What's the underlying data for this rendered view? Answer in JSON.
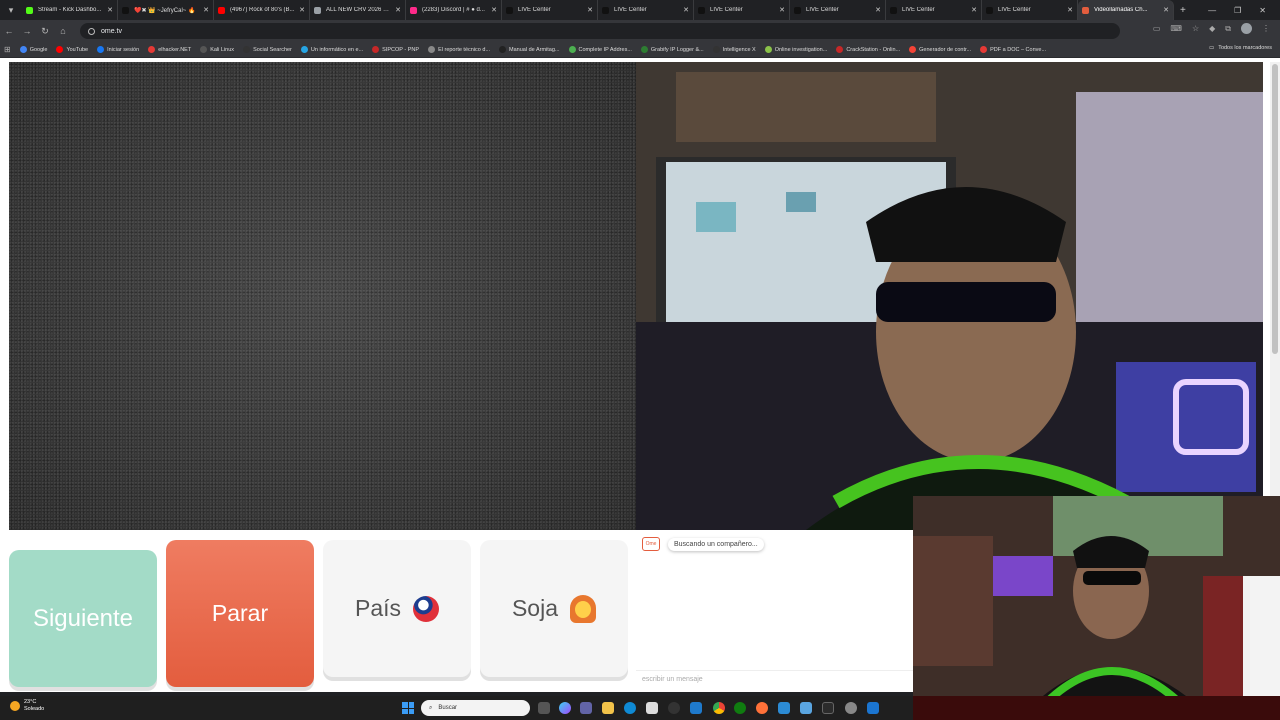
{
  "tabs": [
    {
      "label": "Stream - Kick Dashbo...",
      "color": "#53fc18"
    },
    {
      "label": "❤️✖ 👑 ~JefryCal~ 🔥",
      "color": "#111111"
    },
    {
      "label": "(4967) Rock of 80's (B...",
      "color": "#ff0000"
    },
    {
      "label": "ALL NEW CRV 2026 Ch...",
      "color": "#9aa0a6"
    },
    {
      "label": "(2283) Discord | # ● d...",
      "color": "#ff2a8a"
    },
    {
      "label": "LIVE Center",
      "color": "#111111"
    },
    {
      "label": "LIVE Center",
      "color": "#111111"
    },
    {
      "label": "LIVE Center",
      "color": "#111111"
    },
    {
      "label": "LIVE Center",
      "color": "#111111"
    },
    {
      "label": "LIVE Center",
      "color": "#111111"
    },
    {
      "label": "LIVE Center",
      "color": "#111111"
    },
    {
      "label": "Videollamadas Ch...",
      "color": "#e35d3e",
      "active": true
    }
  ],
  "address": {
    "url": "ome.tv"
  },
  "bookmarks": [
    {
      "label": "Google",
      "color": "#4285f4"
    },
    {
      "label": "YouTube",
      "color": "#ff0000"
    },
    {
      "label": "Iniciar sesión",
      "color": "#1877f2"
    },
    {
      "label": "elhacker.NET",
      "color": "#e53935"
    },
    {
      "label": "Kali Linux",
      "color": "#555555"
    },
    {
      "label": "Social Searcher",
      "color": "#333333"
    },
    {
      "label": "Un informático en e...",
      "color": "#26a5e4"
    },
    {
      "label": "SIPCOP - PNP",
      "color": "#c62828"
    },
    {
      "label": "El reporte técnico d...",
      "color": "#888888"
    },
    {
      "label": "Manual de Armitag...",
      "color": "#222222"
    },
    {
      "label": "Complete IP Addres...",
      "color": "#4caf50"
    },
    {
      "label": "Grabify IP Logger &...",
      "color": "#2e7d32"
    },
    {
      "label": "Intelligence X",
      "color": "#333333"
    },
    {
      "label": "Online investigation...",
      "color": "#8bc34a"
    },
    {
      "label": "CrackStation - Onlin...",
      "color": "#c62828"
    },
    {
      "label": "Generador de contr...",
      "color": "#f44336"
    },
    {
      "label": "PDF a DOC – Conve...",
      "color": "#e53935"
    }
  ],
  "bookmarks_all": "Todos los marcadores",
  "buttons": {
    "next": "Siguiente",
    "stop": "Parar",
    "country": "País",
    "soja": "Soja"
  },
  "chat": {
    "status": "Buscando un compañero...",
    "placeholder": "escribir un mensaje",
    "logo": "Ome"
  },
  "taskbar": {
    "temperature": "23°C",
    "condition": "Soleado",
    "search": "Buscar"
  },
  "colors": {
    "next": "#a3dbc7",
    "stop": "#e35d3e",
    "accent": "#e35d3e"
  }
}
